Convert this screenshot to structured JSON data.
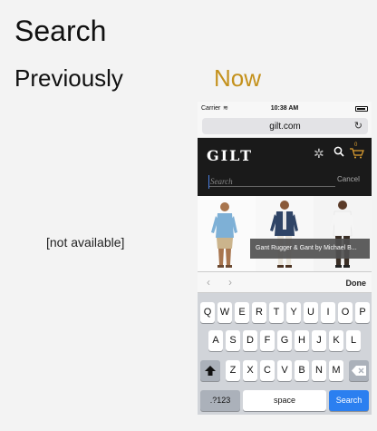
{
  "headings": {
    "title": "Search",
    "previously": "Previously",
    "now": "Now",
    "not_available": "[not available]"
  },
  "colors": {
    "now_accent": "#c4911c",
    "search_key": "#2b7ff0",
    "header_bg": "#1a1a1a"
  },
  "phone": {
    "status": {
      "carrier": "Carrier",
      "time": "10:38 AM"
    },
    "url": "gilt.com",
    "site": {
      "logo": "GILT",
      "cart_count": "0",
      "search_placeholder": "Search",
      "cancel_label": "Cancel",
      "caption": "Gant Rugger & Gant by Michael B..."
    },
    "accessory": {
      "done_label": "Done"
    },
    "keyboard": {
      "row1": [
        "Q",
        "W",
        "E",
        "R",
        "T",
        "Y",
        "U",
        "I",
        "O",
        "P"
      ],
      "row2": [
        "A",
        "S",
        "D",
        "F",
        "G",
        "H",
        "J",
        "K",
        "L"
      ],
      "row3": [
        "Z",
        "X",
        "C",
        "V",
        "B",
        "N",
        "M"
      ],
      "numbers_label": ".?123",
      "space_label": "space",
      "search_label": "Search"
    }
  },
  "icons": {
    "wifi": "wifi-icon",
    "battery": "battery-icon",
    "reload": "reload-icon",
    "gear": "gear-icon",
    "search": "search-icon",
    "cart": "cart-icon",
    "prev": "chevron-left-icon",
    "next": "chevron-right-icon",
    "shift": "shift-icon",
    "delete": "delete-icon"
  }
}
